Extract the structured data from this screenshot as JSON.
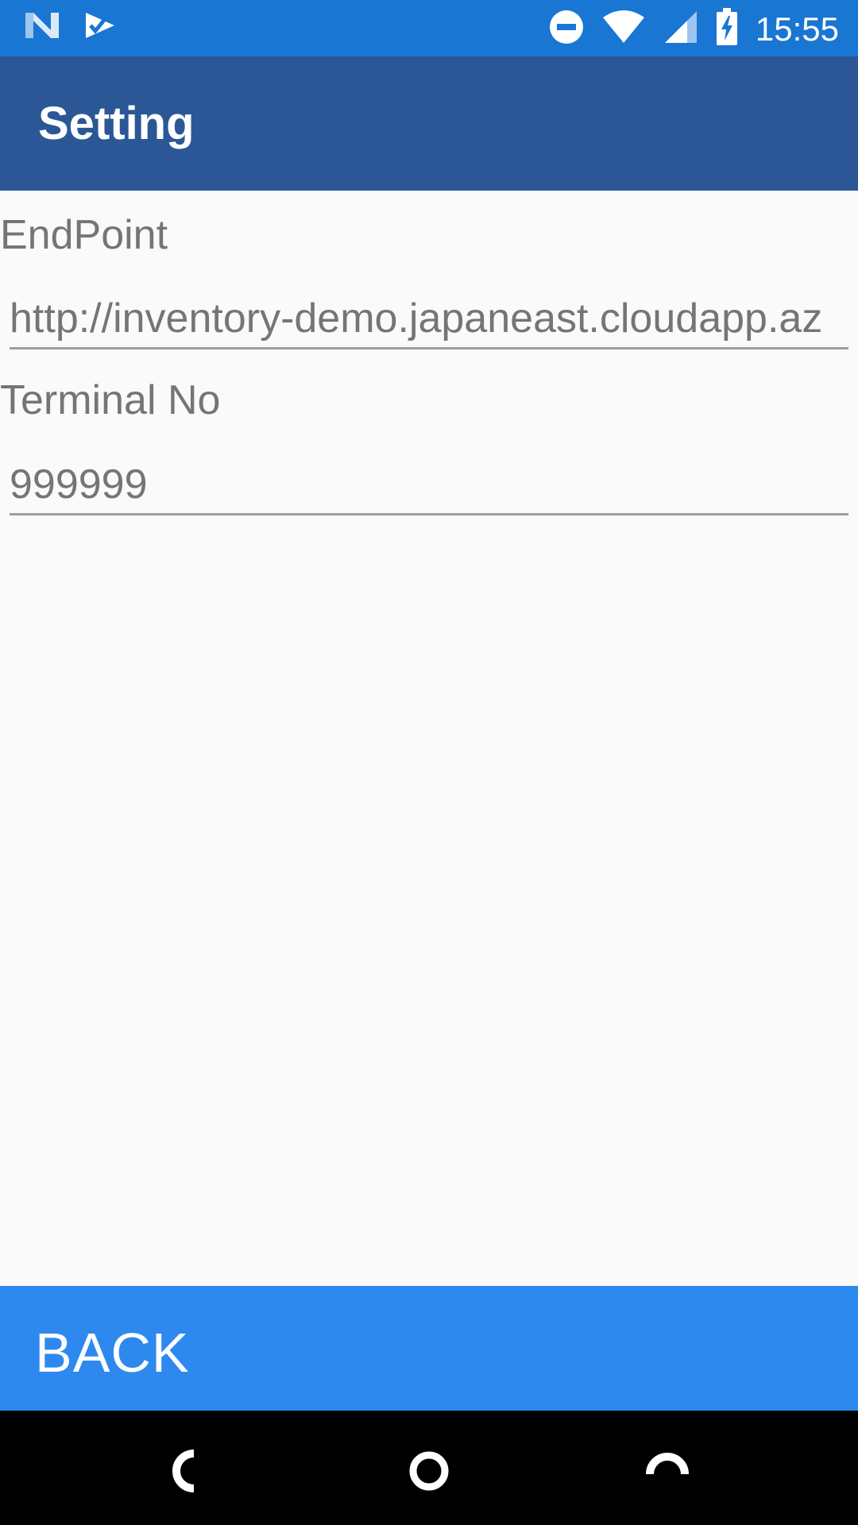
{
  "status_bar": {
    "time": "15:55",
    "left_icons": [
      "n-notification-icon",
      "checklist-notification-icon"
    ],
    "right_icons": [
      "do-not-disturb-icon",
      "wifi-icon",
      "cell-signal-icon",
      "battery-charging-icon"
    ],
    "color": "#1976d2"
  },
  "app_bar": {
    "title": "Setting",
    "color": "#2b5797"
  },
  "form": {
    "endpoint_label": "EndPoint",
    "endpoint_value": "http://inventory-demo.japaneast.cloudapp.az",
    "terminal_label": "Terminal No",
    "terminal_value": "999999"
  },
  "footer": {
    "back_label": "BACK",
    "color": "#2e89ee"
  },
  "nav_bar": {
    "buttons": [
      "back-nav-icon",
      "home-nav-icon",
      "recents-nav-icon"
    ]
  }
}
